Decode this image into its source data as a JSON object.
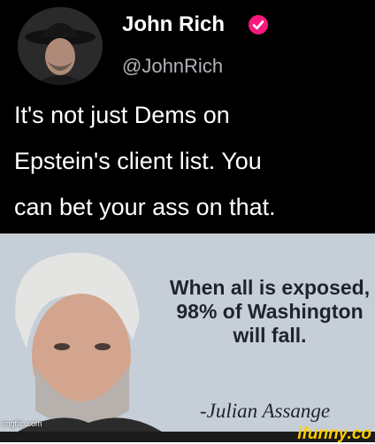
{
  "tweet": {
    "display_name": "John Rich",
    "handle": "@JohnRich",
    "text": "It's not just Dems on\nEpstein's client list. You\ncan bet your ass on that.",
    "verified_icon": "verified-badge-icon",
    "verified_color": "#f91880"
  },
  "quote_panel": {
    "quote": "When all is exposed, 98% of Washington will fall.",
    "attribution": "-Julian Assange",
    "background": "#c6cfd8"
  },
  "watermarks": {
    "imgflip": "imgflip.com",
    "ifunny": "ifunny.co"
  }
}
